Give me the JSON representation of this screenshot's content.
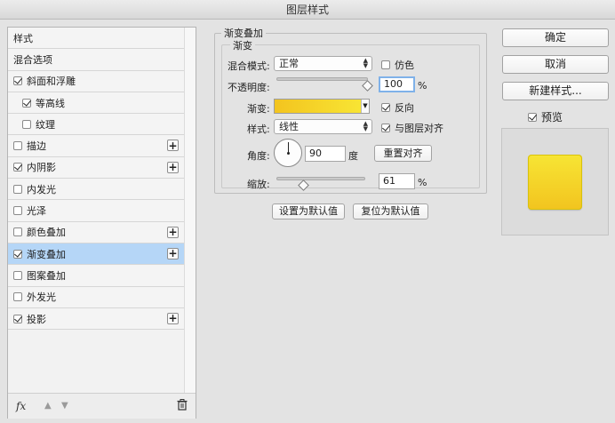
{
  "window": {
    "title": "图层样式"
  },
  "left_panel": {
    "items": [
      {
        "label": "样式",
        "checkbox": false,
        "checked": false,
        "plus": false,
        "indent": false,
        "selected": false
      },
      {
        "label": "混合选项",
        "checkbox": false,
        "checked": false,
        "plus": false,
        "indent": false,
        "selected": false
      },
      {
        "label": "斜面和浮雕",
        "checkbox": true,
        "checked": true,
        "plus": false,
        "indent": false,
        "selected": false
      },
      {
        "label": "等高线",
        "checkbox": true,
        "checked": true,
        "plus": false,
        "indent": true,
        "selected": false
      },
      {
        "label": "纹理",
        "checkbox": true,
        "checked": false,
        "plus": false,
        "indent": true,
        "selected": false
      },
      {
        "label": "描边",
        "checkbox": true,
        "checked": false,
        "plus": true,
        "indent": false,
        "selected": false
      },
      {
        "label": "内阴影",
        "checkbox": true,
        "checked": true,
        "plus": true,
        "indent": false,
        "selected": false
      },
      {
        "label": "内发光",
        "checkbox": true,
        "checked": false,
        "plus": false,
        "indent": false,
        "selected": false
      },
      {
        "label": "光泽",
        "checkbox": true,
        "checked": false,
        "plus": false,
        "indent": false,
        "selected": false
      },
      {
        "label": "颜色叠加",
        "checkbox": true,
        "checked": false,
        "plus": true,
        "indent": false,
        "selected": false
      },
      {
        "label": "渐变叠加",
        "checkbox": true,
        "checked": true,
        "plus": true,
        "indent": false,
        "selected": true
      },
      {
        "label": "图案叠加",
        "checkbox": true,
        "checked": false,
        "plus": false,
        "indent": false,
        "selected": false
      },
      {
        "label": "外发光",
        "checkbox": true,
        "checked": false,
        "plus": false,
        "indent": false,
        "selected": false
      },
      {
        "label": "投影",
        "checkbox": true,
        "checked": true,
        "plus": true,
        "indent": false,
        "selected": false
      }
    ],
    "footer": {
      "fx_label": "fx",
      "trash_icon": "trash-icon"
    }
  },
  "gradient_overlay": {
    "section_title": "渐变叠加",
    "subsection_title": "渐变",
    "blend_mode": {
      "label": "混合模式:",
      "value": "正常"
    },
    "dither": {
      "label": "仿色",
      "checked": false
    },
    "opacity": {
      "label": "不透明度:",
      "value": "100",
      "unit": "%",
      "slider_fraction": 1.0
    },
    "gradient": {
      "label": "渐变:",
      "colors": [
        "#f3c41f",
        "#f8e534"
      ]
    },
    "reverse": {
      "label": "反向",
      "checked": true
    },
    "style": {
      "label": "样式:",
      "value": "线性"
    },
    "align_with_layer": {
      "label": "与图层对齐",
      "checked": true
    },
    "angle": {
      "label": "角度:",
      "value": "90",
      "unit": "度",
      "reset_button": "重置对齐"
    },
    "scale": {
      "label": "缩放:",
      "value": "61",
      "unit": "%",
      "slider_fraction": 0.61
    },
    "make_default": "设置为默认值",
    "reset_default": "复位为默认值"
  },
  "right_panel": {
    "ok": "确定",
    "cancel": "取消",
    "new_style": "新建样式...",
    "preview": {
      "label": "预览",
      "checked": true
    },
    "preview_colors": [
      "#f7e534",
      "#f2c41f"
    ]
  }
}
